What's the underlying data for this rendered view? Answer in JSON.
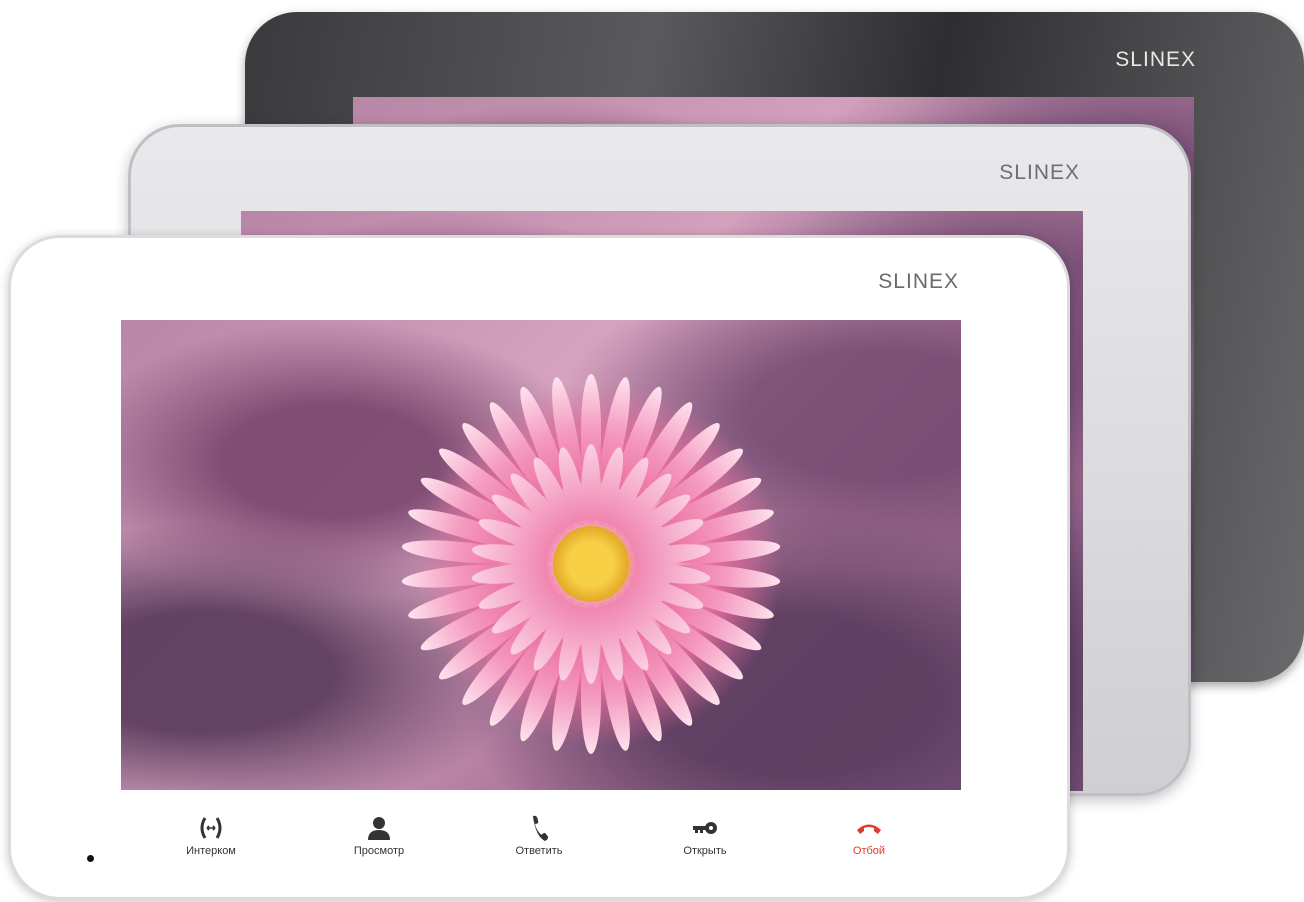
{
  "brand": "SLINEX",
  "devices": [
    {
      "name": "black-monitor",
      "logo": "SLINEX"
    },
    {
      "name": "silver-monitor",
      "logo": "SLINEX"
    },
    {
      "name": "white-monitor",
      "logo": "SLINEX"
    }
  ],
  "buttons": [
    {
      "label": "Интерком",
      "icon": "intercom-icon"
    },
    {
      "label": "Просмотр",
      "icon": "person-icon"
    },
    {
      "label": "Ответить",
      "icon": "handset-icon"
    },
    {
      "label": "Открыть",
      "icon": "key-icon"
    },
    {
      "label": "Отбой",
      "icon": "hang-up-icon",
      "color": "#e23a2e"
    }
  ],
  "colors": {
    "frame_black": "#3a3a3c",
    "frame_silver": "#dcdcdf",
    "frame_white": "#ffffff",
    "hangup_red": "#e23a2e"
  }
}
